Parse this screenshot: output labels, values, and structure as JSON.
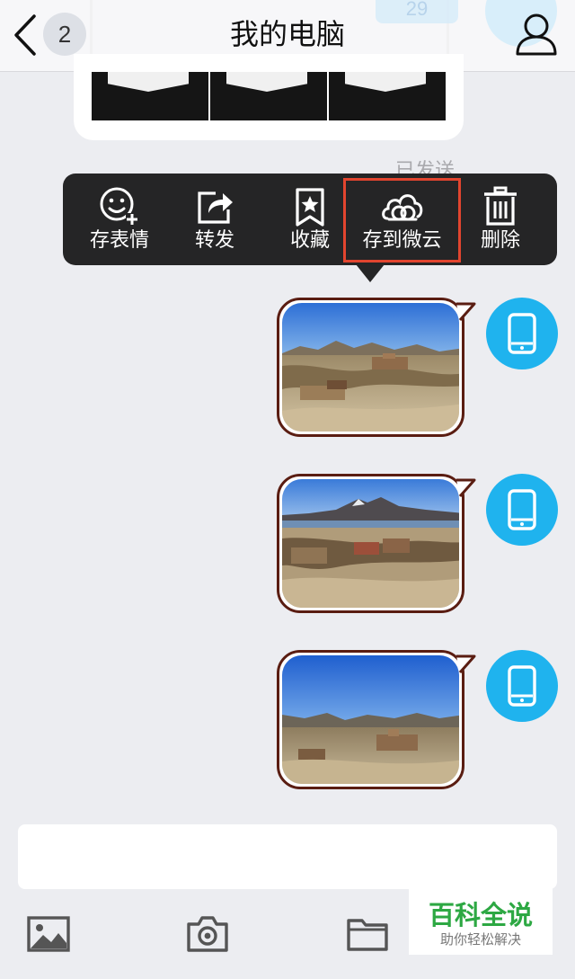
{
  "header": {
    "title": "我的电脑",
    "unread_count": "2",
    "background_ghost_count": "29"
  },
  "messages": {
    "sent_status": "已发送"
  },
  "context_menu": {
    "items": [
      {
        "label": "存表情",
        "icon": "sticker-add-icon"
      },
      {
        "label": "转发",
        "icon": "forward-share-icon"
      },
      {
        "label": "收藏",
        "icon": "bookmark-star-icon"
      },
      {
        "label": "存到微云",
        "icon": "weiyun-cloud-icon",
        "highlighted": true
      },
      {
        "label": "删除",
        "icon": "trash-icon"
      }
    ],
    "highlight_color": "#e2452f"
  },
  "toolbar": {
    "icons": [
      "image-icon",
      "camera-icon",
      "folder-icon"
    ]
  },
  "watermark": {
    "main": "百科全说",
    "sub": "助你轻松解决"
  },
  "colors": {
    "background": "#ecedf1",
    "menu_bg": "#252526",
    "avatar": "#1fb3ee",
    "bubble_border": "#5a1d12",
    "watermark_green": "#2da843"
  }
}
